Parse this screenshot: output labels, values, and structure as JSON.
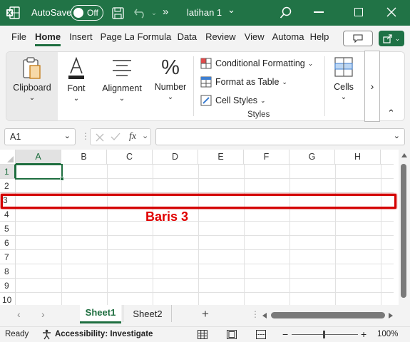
{
  "titlebar": {
    "autosave_label": "AutoSave",
    "autosave_state": "Off",
    "more_glyph": "»",
    "file_title": "latihan 1",
    "file_title_chevron": "⌄"
  },
  "menu": {
    "tabs": [
      "File",
      "Home",
      "Insert",
      "Page La",
      "Formula",
      "Data",
      "Review",
      "View",
      "Automa",
      "Help"
    ],
    "selected": "Home"
  },
  "ribbon": {
    "clipboard_label": "Clipboard",
    "font_label": "Font",
    "alignment_label": "Alignment",
    "number_label": "Number",
    "conditional_formatting": "Conditional Formatting",
    "format_as_table": "Format as Table",
    "cell_styles": "Cell Styles",
    "styles_group_label": "Styles",
    "cells_label": "Cells",
    "more_glyph": "›",
    "collapse_glyph": "⌃"
  },
  "formula_bar": {
    "name_box_value": "A1",
    "fx_label": "fx",
    "formula_value": ""
  },
  "grid": {
    "columns": [
      "A",
      "B",
      "C",
      "D",
      "E",
      "F",
      "G",
      "H"
    ],
    "rows": [
      "1",
      "2",
      "3",
      "4",
      "5",
      "6",
      "7",
      "8",
      "9",
      "10"
    ],
    "active_cell": "A1",
    "highlighted_row": "3",
    "annotation": "Baris 3",
    "annotation_color": "#e00000"
  },
  "sheets": {
    "tabs": [
      "Sheet1",
      "Sheet2"
    ],
    "active": "Sheet1",
    "add_glyph": "+"
  },
  "status": {
    "ready": "Ready",
    "accessibility": "Accessibility: Investigate",
    "zoom_minus": "−",
    "zoom_plus": "+",
    "zoom": "100%"
  },
  "colors": {
    "title_bar": "#217346",
    "accent_green": "#1e6e3f",
    "highlight_red": "#e00000"
  }
}
